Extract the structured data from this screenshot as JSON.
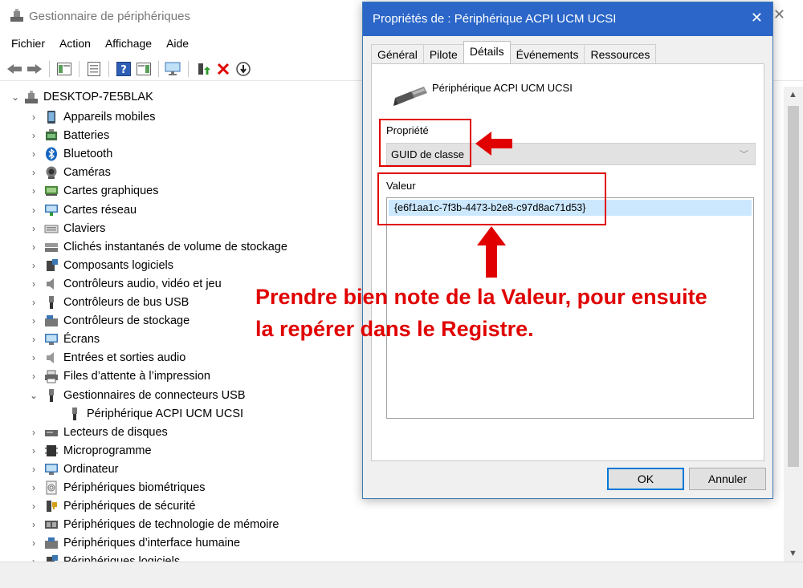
{
  "main": {
    "title": "Gestionnaire de périphériques",
    "menu": [
      "Fichier",
      "Action",
      "Affichage",
      "Aide"
    ],
    "tree_root": "DESKTOP-7E5BLAK",
    "categories": [
      {
        "label": "Appareils mobiles",
        "icon": "mobile-devices-icon",
        "expanded": false
      },
      {
        "label": "Batteries",
        "icon": "battery-icon",
        "expanded": false
      },
      {
        "label": "Bluetooth",
        "icon": "bluetooth-icon",
        "expanded": false
      },
      {
        "label": "Caméras",
        "icon": "camera-icon",
        "expanded": false
      },
      {
        "label": "Cartes graphiques",
        "icon": "display-adapter-icon",
        "expanded": false
      },
      {
        "label": "Cartes réseau",
        "icon": "network-adapter-icon",
        "expanded": false
      },
      {
        "label": "Claviers",
        "icon": "keyboard-icon",
        "expanded": false
      },
      {
        "label": "Clichés instantanés de volume de stockage",
        "icon": "storage-volume-icon",
        "expanded": false
      },
      {
        "label": "Composants logiciels",
        "icon": "software-component-icon",
        "expanded": false
      },
      {
        "label": "Contrôleurs audio, vidéo et jeu",
        "icon": "audio-icon",
        "expanded": false
      },
      {
        "label": "Contrôleurs de bus USB",
        "icon": "usb-icon",
        "expanded": false
      },
      {
        "label": "Contrôleurs de stockage",
        "icon": "storage-controller-icon",
        "expanded": false
      },
      {
        "label": "Écrans",
        "icon": "monitor-icon",
        "expanded": false
      },
      {
        "label": "Entrées et sorties audio",
        "icon": "speaker-icon",
        "expanded": false
      },
      {
        "label": "Files d’attente à l’impression",
        "icon": "printer-icon",
        "expanded": false
      },
      {
        "label": "Gestionnaires de connecteurs USB",
        "icon": "usb-connector-icon",
        "expanded": true
      },
      {
        "label": "Périphérique ACPI UCM UCSI",
        "icon": "usb-device-icon",
        "child": true
      },
      {
        "label": "Lecteurs de disques",
        "icon": "disk-drive-icon",
        "expanded": false
      },
      {
        "label": "Microprogramme",
        "icon": "firmware-icon",
        "expanded": false
      },
      {
        "label": "Ordinateur",
        "icon": "computer-icon",
        "expanded": false
      },
      {
        "label": "Périphériques biométriques",
        "icon": "fingerprint-icon",
        "expanded": false
      },
      {
        "label": "Périphériques de sécurité",
        "icon": "security-key-icon",
        "expanded": false
      },
      {
        "label": "Périphériques de technologie de mémoire",
        "icon": "memory-icon",
        "expanded": false
      },
      {
        "label": "Périphériques d’interface humaine",
        "icon": "hid-icon",
        "expanded": false
      },
      {
        "label": "Périphériques logiciels",
        "icon": "software-device-icon",
        "expanded": false
      }
    ]
  },
  "dialog": {
    "title": "Propriétés de : Périphérique ACPI UCM UCSI",
    "tabs": [
      "Général",
      "Pilote",
      "Détails",
      "Événements",
      "Ressources"
    ],
    "active_tab": "Détails",
    "device_name": "Périphérique ACPI UCM UCSI",
    "property_label": "Propriété",
    "property_value": "GUID de classe",
    "value_label": "Valeur",
    "value": "{e6f1aa1c-7f3b-4473-b2e8-c97d8ac71d53}",
    "ok_label": "OK",
    "cancel_label": "Annuler"
  },
  "annotation": {
    "line1": "Prendre bien note de la Valeur, pour ensuite",
    "line2": "la repérer dans le Registre."
  },
  "colors": {
    "annotation": "#e00000",
    "dialog_title": "#2b66c8",
    "selection": "#cce8ff"
  }
}
